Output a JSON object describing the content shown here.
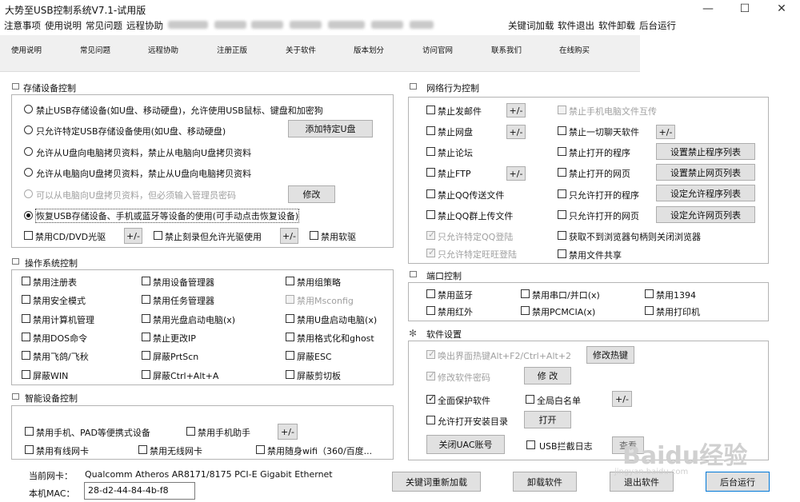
{
  "window": {
    "title": "大势至USB控制系统V7.1-试用版",
    "controls": [
      "—",
      "☐",
      "✕"
    ]
  },
  "menu": {
    "left": [
      "注意事项",
      "使用说明",
      "常见问题",
      "远程协助"
    ],
    "right": [
      "关键词加载",
      "软件退出",
      "软件卸载",
      "后台运行"
    ]
  },
  "tabs": [
    "使用说明",
    "常见问题",
    "远程协助",
    "注册正版",
    "关于软件",
    "版本划分",
    "访问官网",
    "联系我们",
    "在线购买"
  ],
  "storage": {
    "title": "存储设备控制",
    "radios": [
      "禁止USB存储设备(如U盘、移动硬盘)，允许使用USB鼠标、键盘和加密狗",
      "只允许特定USB存储设备使用(如U盘、移动硬盘)",
      "允许从U盘向电脑拷贝资料，禁止从电脑向U盘拷贝资料",
      "允许从电脑向U盘拷贝资料，禁止从U盘向电脑拷贝资料",
      "可以从电脑向U盘拷贝资料，但必须输入管理员密码",
      "恢复USB存储设备、手机或蓝牙等设备的使用(可手动点击恢复设备)"
    ],
    "add_udisk_btn": "添加特定U盘",
    "modify_btn": "修改",
    "cd_label": "禁用CD/DVD光驱",
    "burn_label": "禁止刻录但允许光驱使用",
    "floppy_label": "禁用软驱",
    "pm_btn": "+/-"
  },
  "os": {
    "title": "操作系统控制",
    "items": [
      "禁用注册表",
      "禁用设备管理器",
      "禁用组策略",
      "禁用安全模式",
      "禁用任务管理器",
      "禁用Msconfig",
      "禁用计算机管理",
      "禁用光盘启动电脑(x)",
      "禁用U盘启动电脑(x)",
      "禁用DOS命令",
      "禁止更改IP",
      "禁用格式化和ghost",
      "禁用飞鸽/飞秋",
      "屏蔽PrtScn",
      "屏蔽ESC",
      "屏蔽WIN",
      "屏蔽Ctrl+Alt+A",
      "屏蔽剪切板"
    ]
  },
  "smart": {
    "title": "智能设备控制",
    "items": [
      "禁用手机、PAD等便携式设备",
      "禁用手机助手",
      "禁用有线网卡",
      "禁用无线网卡",
      "禁用随身wifi（360/百度..."
    ],
    "pm_btn": "+/-"
  },
  "nic": {
    "label": "当前网卡：",
    "value": "Qualcomm Atheros AR8171/8175 PCI-E Gigabit Ethernet",
    "mac_label": "本机MAC：",
    "mac_value": "28-d2-44-84-4b-f8"
  },
  "network": {
    "title": "网络行为控制",
    "left_items": [
      "禁止发邮件",
      "禁止网盘",
      "禁止论坛",
      "禁止FTP",
      "禁止QQ传送文件",
      "禁止QQ群上传文件",
      "只允许特定QQ登陆",
      "只允许特定旺旺登陆"
    ],
    "right_items": [
      "禁止手机电脑文件互传",
      "禁止一切聊天软件",
      "禁止打开的程序",
      "禁止打开的网页",
      "只允许打开的程序",
      "只允许打开的网页",
      "获取不到浏览器句柄则关闭浏览器",
      "禁用文件共享"
    ],
    "buttons": [
      "设置禁止程序列表",
      "设置禁止网页列表",
      "设定允许程序列表",
      "设定允许网页列表"
    ],
    "pm_btn": "+/-"
  },
  "port": {
    "title": "端口控制",
    "items": [
      "禁用蓝牙",
      "禁用串口/并口(x)",
      "禁用1394",
      "禁用红外",
      "禁用PCMCIA(x)",
      "禁用打印机"
    ]
  },
  "settings": {
    "title": "软件设置",
    "hotkey_label": "唤出界面热键Alt+F2/Ctrl+Alt+2",
    "hotkey_btn": "修改热键",
    "pwd_label": "修改软件密码",
    "pwd_btn": "修 改",
    "protect_label": "全面保护软件",
    "whitelist_label": "全局白名单",
    "pm_btn": "+/-",
    "install_label": "允许打开安装目录",
    "open_btn": "打开",
    "uac_btn": "关闭UAC账号",
    "usblog_label": "USB拦截日志",
    "small_btn": "查看"
  },
  "bottom": {
    "reload": "关键词重新加载",
    "uninstall": "卸载软件",
    "exit": "退出软件",
    "background": "后台运行"
  },
  "watermark": "Baidu经验",
  "watermark_sub": "jingyan.baidu.com"
}
